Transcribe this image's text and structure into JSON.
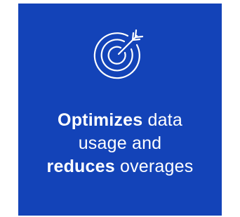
{
  "tile": {
    "background_color": "#1343b8",
    "icon": "target-with-arrow-icon",
    "caption": {
      "line1_bold": "Optimizes",
      "line1_rest": " data",
      "line2": "usage and",
      "line3_bold": "reduces",
      "line3_rest": " overages"
    }
  }
}
